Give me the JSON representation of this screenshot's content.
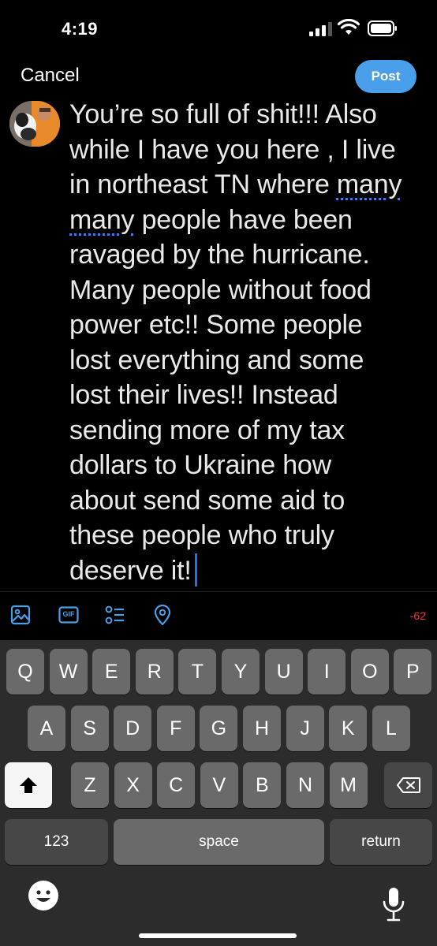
{
  "status": {
    "time": "4:19"
  },
  "header": {
    "cancel_label": "Cancel",
    "post_label": "Post"
  },
  "composer": {
    "lines": [
      "You’re so full of shit!!! Also",
      "while I have you here , I live",
      "in northeast TN where many",
      "many people have been",
      "ravaged by the hurricane.",
      "Many people without food",
      "power etc!! Some people",
      "lost everything and some",
      "lost their lives!! Instead",
      "sending more of my tax",
      "dollars to Ukraine how",
      "about send some aid to",
      "these people who truly",
      "deserve it!"
    ],
    "line3_prefix": "in northeast TN where ",
    "line3_underlined": "many",
    "line4_underlined": "many",
    "line4_suffix": " people have been"
  },
  "toolbar": {
    "icons": [
      "image-icon",
      "gif-icon",
      "poll-icon",
      "location-icon"
    ],
    "gif_label": "GIF",
    "char_count": "-62",
    "accent": "#4a9fea",
    "count_color": "#f0342b"
  },
  "keyboard": {
    "row1": [
      "Q",
      "W",
      "E",
      "R",
      "T",
      "Y",
      "U",
      "I",
      "O",
      "P"
    ],
    "row2": [
      "A",
      "S",
      "D",
      "F",
      "G",
      "H",
      "J",
      "K",
      "L"
    ],
    "row3": [
      "Z",
      "X",
      "C",
      "V",
      "B",
      "N",
      "M"
    ],
    "numbers_label": "123",
    "space_label": "space",
    "return_label": "return"
  }
}
